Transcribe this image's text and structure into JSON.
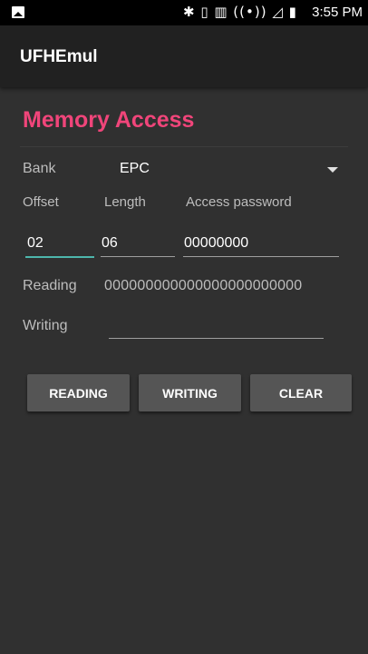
{
  "status_bar": {
    "time": "3:55 PM",
    "icons": [
      "image-notification-icon",
      "bluetooth-icon",
      "vibrate-icon",
      "barcode-icon",
      "hotspot-icon",
      "no-signal-icon",
      "battery-icon"
    ],
    "icon_glyphs": "✱ ▯ ▥ ((•)) ◿ ▮"
  },
  "app_bar": {
    "title": "UFHEmul"
  },
  "section": {
    "title": "Memory Access",
    "accent_color": "#f0457a"
  },
  "bank": {
    "label": "Bank",
    "selected": "EPC"
  },
  "fields": {
    "offset_label": "Offset",
    "offset_value": "02",
    "length_label": "Length",
    "length_value": "06",
    "password_label": "Access password",
    "password_value": "00000000",
    "focus_color": "#4db6ac"
  },
  "reading": {
    "label": "Reading",
    "value": "000000000000000000000000"
  },
  "writing": {
    "label": "Writing",
    "value": ""
  },
  "buttons": {
    "reading": "READING",
    "writing": "WRITING",
    "clear": "CLEAR"
  }
}
